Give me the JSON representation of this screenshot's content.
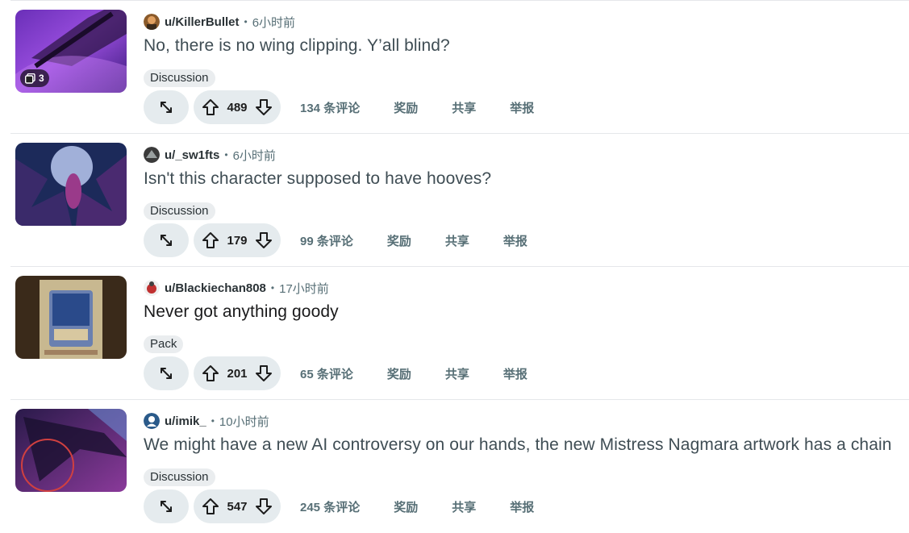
{
  "posts": [
    {
      "user": "u/KillerBullet",
      "time": "6小时前",
      "title": "No, there is no wing clipping. Y’all blind?",
      "flair": "Discussion",
      "gallery_count": "3",
      "votes": "489",
      "comments": "134 条评论",
      "award": "奖励",
      "share": "共享",
      "report": "举报"
    },
    {
      "user": "u/_sw1fts",
      "time": "6小时前",
      "title": "Isn't this character supposed to have hooves?",
      "flair": "Discussion",
      "votes": "179",
      "comments": "99 条评论",
      "award": "奖励",
      "share": "共享",
      "report": "举报"
    },
    {
      "user": "u/Blackiechan808",
      "time": "17小时前",
      "title": "Never got anything goody",
      "flair": "Pack",
      "votes": "201",
      "comments": "65 条评论",
      "award": "奖励",
      "share": "共享",
      "report": "举报"
    },
    {
      "user": "u/imik_",
      "time": "10小时前",
      "title": "We might have a new AI controversy on our hands, the new Mistress Nagmara artwork has a chain",
      "flair": "Discussion",
      "votes": "547",
      "comments": "245 条评论",
      "award": "奖励",
      "share": "共享",
      "report": "举报"
    }
  ],
  "dot": "•",
  "colors": {
    "pill_bg": "#e5ebee",
    "meta_gray": "#576f76",
    "divider": "#e5e7ea"
  }
}
